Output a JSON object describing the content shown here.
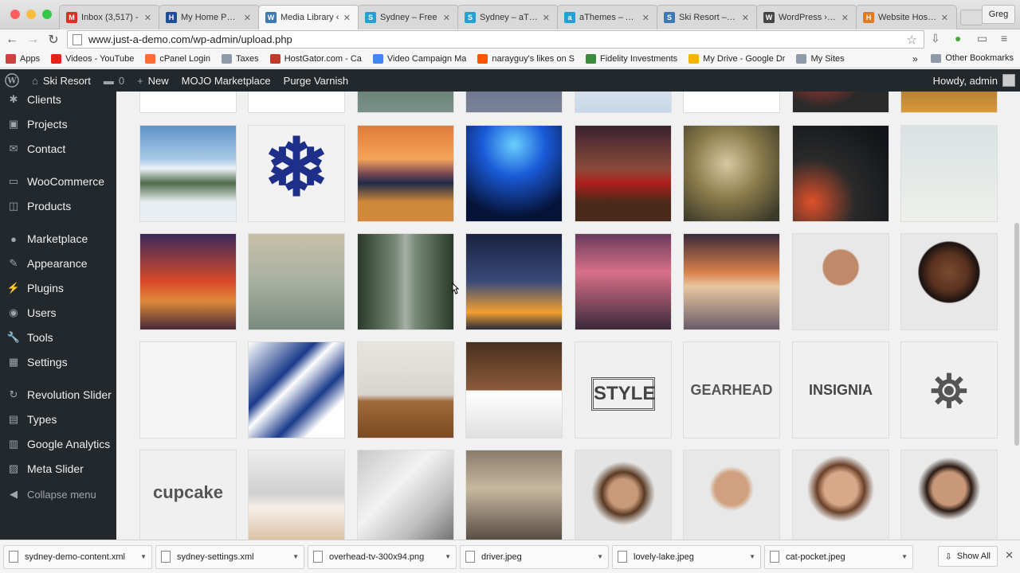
{
  "browser": {
    "tabs": [
      {
        "title": "Inbox (3,517) -",
        "icon": "gmail-icon",
        "color": "#d93025",
        "glyph": "M",
        "active": false
      },
      {
        "title": "My Home Page",
        "icon": "hostgator-icon",
        "color": "#1f4e99",
        "glyph": "H",
        "active": false
      },
      {
        "title": "Media Library ‹",
        "icon": "wordpress-admin-icon",
        "color": "#3d7ab5",
        "glyph": "W",
        "active": true
      },
      {
        "title": "Sydney – Free",
        "icon": "athemes-icon",
        "color": "#1fa3d6",
        "glyph": "S",
        "active": false
      },
      {
        "title": "Sydney – aThem",
        "icon": "athemes-icon",
        "color": "#1fa3d6",
        "glyph": "S",
        "active": false
      },
      {
        "title": "aThemes – Awe",
        "icon": "athemes-icon",
        "color": "#1fa3d6",
        "glyph": "a",
        "active": false
      },
      {
        "title": "Ski Resort – Jus",
        "icon": "site-icon",
        "color": "#3d7ab5",
        "glyph": "S",
        "active": false
      },
      {
        "title": "WordPress › Sy",
        "icon": "wordpress-icon",
        "color": "#464646",
        "glyph": "W",
        "active": false
      },
      {
        "title": "Website Hosting",
        "icon": "hosting-icon",
        "color": "#e07b24",
        "glyph": "H",
        "active": false
      }
    ],
    "profile": "Greg",
    "url": "www.just-a-demo.com/wp-admin/upload.php",
    "bookmarks": [
      {
        "label": "Apps",
        "color": "#d04040"
      },
      {
        "label": "Videos - YouTube",
        "color": "#e62117"
      },
      {
        "label": "cPanel Login",
        "color": "#ff6c2c"
      },
      {
        "label": "Taxes",
        "color": "#8e9aa8"
      },
      {
        "label": "HostGator.com - Ca",
        "color": "#c0392b"
      },
      {
        "label": "Video Campaign Ma",
        "color": "#4285f4"
      },
      {
        "label": "narayguy's likes on S",
        "color": "#ff5500"
      },
      {
        "label": "Fidelity Investments",
        "color": "#3b8c3b"
      },
      {
        "label": "My Drive - Google Dr",
        "color": "#f4b400"
      },
      {
        "label": "My Sites",
        "color": "#8e9aa8"
      }
    ],
    "other_bookmarks": "Other Bookmarks"
  },
  "adminbar": {
    "site": "Ski Resort",
    "comments": "0",
    "new": "New",
    "mojo": "MOJO Marketplace",
    "purge": "Purge Varnish",
    "howdy": "Howdy, admin"
  },
  "sidebar": {
    "items": [
      {
        "label": "Clients",
        "icon": "clients-icon",
        "glyph": "✱"
      },
      {
        "label": "Projects",
        "icon": "projects-icon",
        "glyph": "▣"
      },
      {
        "label": "Contact",
        "icon": "contact-icon",
        "glyph": "✉"
      },
      {
        "label": "WooCommerce",
        "icon": "woocommerce-icon",
        "glyph": "▭"
      },
      {
        "label": "Products",
        "icon": "products-icon",
        "glyph": "◫"
      },
      {
        "label": "Marketplace",
        "icon": "marketplace-icon",
        "glyph": "●"
      },
      {
        "label": "Appearance",
        "icon": "appearance-icon",
        "glyph": "✎"
      },
      {
        "label": "Plugins",
        "icon": "plugins-icon",
        "glyph": "⚡"
      },
      {
        "label": "Users",
        "icon": "users-icon",
        "glyph": "◉"
      },
      {
        "label": "Tools",
        "icon": "tools-icon",
        "glyph": "🔧"
      },
      {
        "label": "Settings",
        "icon": "settings-icon",
        "glyph": "▦"
      },
      {
        "label": "Revolution Slider",
        "icon": "revolution-slider-icon",
        "glyph": "↻"
      },
      {
        "label": "Types",
        "icon": "types-icon",
        "glyph": "▤"
      },
      {
        "label": "Google Analytics",
        "icon": "analytics-icon",
        "glyph": "▥"
      },
      {
        "label": "Meta Slider",
        "icon": "meta-slider-icon",
        "glyph": "▨"
      }
    ],
    "collapse": "Collapse menu"
  },
  "media_grid": {
    "tiles": [
      {
        "name": "thumb-top-1",
        "bg": "#ffffff"
      },
      {
        "name": "thumb-top-2",
        "bg": "#ffffff"
      },
      {
        "name": "thumb-top-3",
        "bg": "linear-gradient(#3a5a48,#7a9088)"
      },
      {
        "name": "thumb-top-4",
        "bg": "linear-gradient(#4b5a78,#7b8298)"
      },
      {
        "name": "thumb-top-5",
        "bg": "linear-gradient(#ffffff,#c8d8e8)"
      },
      {
        "name": "thumb-top-6",
        "bg": "#ffffff"
      },
      {
        "name": "thumb-top-7",
        "bg": "radial-gradient(circle at 30% 40%,#c0382e 20%,#2a2a2a 60%)"
      },
      {
        "name": "thumb-top-8",
        "bg": "linear-gradient(#3a2a10,#d89a3a)"
      },
      {
        "name": "thumb-snowy-mountains",
        "bg": "linear-gradient(#5d93c8 0%,#a9c9e6 35%,#eef2f5 45%,#4e6a4a 60%,#e9eef3 80%)"
      },
      {
        "name": "thumb-snowflake",
        "bg": "#f2f2f2",
        "label": "❄",
        "labelColor": "#1e2f8a",
        "labelSize": "100px",
        "labelTop": "-6px"
      },
      {
        "name": "thumb-sunset-lake",
        "bg": "linear-gradient(#e07a3a 0%,#f3a45a 35%,#7a4a52 50%,#1e2a4a 60%,#d0883a 80%)"
      },
      {
        "name": "thumb-concert",
        "bg": "radial-gradient(circle at 50% 20%,#6ad0ff 0%,#1a5ad8 35%,#061338 80%)"
      },
      {
        "name": "thumb-red-car",
        "bg": "linear-gradient(#3a2230 0%,#8a4a3a 45%,#b01e1e 60%,#4a2a1a 80%)"
      },
      {
        "name": "thumb-woman-field",
        "bg": "radial-gradient(circle at 45% 40%,#d8c8a0 0%,#8a7a4a 45%,#3a3a2a 90%)"
      },
      {
        "name": "thumb-bicycle-night",
        "bg": "radial-gradient(circle at 20% 80%,#e0502a 0%,#2a2a2a 40%,#101418 90%)"
      },
      {
        "name": "thumb-sky-plane",
        "bg": "linear-gradient(#d9e2e4,#eef0ea)"
      },
      {
        "name": "thumb-liberty-lightning",
        "bg": "linear-gradient(#3a2a5a 0%,#d84a2a 50%,#e08a3a 70%,#4a2a3a 100%)"
      },
      {
        "name": "thumb-daisy-lake",
        "bg": "linear-gradient(#c8c0a8 0%,#a8b0a0 50%,#7a8a80 100%)"
      },
      {
        "name": "thumb-forest-road",
        "bg": "linear-gradient(90deg,#2a3a2a 0%,#7a8a7a 40%,#a8b0a8 50%,#7a8a7a 60%,#2a3a2a 100%)"
      },
      {
        "name": "thumb-airplane",
        "bg": "linear-gradient(#1a2240 0%,#3a4a7a 50%,#f0a030 82%,#2a2a3a 100%)"
      },
      {
        "name": "thumb-flying-robot",
        "bg": "linear-gradient(#6a3a5a 0%,#d8708a 40%,#3a2a3a 100%)"
      },
      {
        "name": "thumb-girl-dock",
        "bg": "linear-gradient(#3a2a3a 0%,#d8804a 40%,#e8c8a0 55%,#6a5a6a 100%)"
      },
      {
        "name": "thumb-man-portrait",
        "bg": "radial-gradient(circle at 50% 35%,#c08a6a 0%,#c08a6a 22%,#e8e8e8 24%,#e8e8e8 100%)"
      },
      {
        "name": "thumb-woman-portrait",
        "bg": "radial-gradient(circle at 50% 40%,#7a4a30 0%,#5a3220 25%,#1a1210 40%,#e8e8e8 42%)"
      },
      {
        "name": "thumb-businessman",
        "bg": "#f5f5f5"
      },
      {
        "name": "thumb-iphones",
        "bg": "linear-gradient(135deg,#ffffff 0%,#1a3a8a 35%,#ffffff 45%,#1a3a8a 65%,#ffffff 80%)"
      },
      {
        "name": "thumb-desk-glasses",
        "bg": "linear-gradient(#e8e4de 0%,#d8d4ce 55%,#a06a3a 62%,#7a4a22 100%)"
      },
      {
        "name": "thumb-ipad-keyboard",
        "bg": "linear-gradient(#4a3020 0%,#8a5a3a 50%,#ffffff 51%,#e0e0e0 100%)"
      },
      {
        "name": "thumb-style-logo",
        "bg": "#f0f0f0",
        "label": "STYLE",
        "labelColor": "#444",
        "labelSize": "24px",
        "labelTop": "44px",
        "border": true
      },
      {
        "name": "thumb-gearhead-logo",
        "bg": "#f0f0f0",
        "label": "GEARHEAD",
        "labelColor": "#555",
        "labelSize": "18px",
        "labelTop": "50px"
      },
      {
        "name": "thumb-insignia-logo",
        "bg": "#f0f0f0",
        "label": "INSIGNIA",
        "labelColor": "#444",
        "labelSize": "18px",
        "labelTop": "50px"
      },
      {
        "name": "thumb-lighthouse-logo",
        "bg": "#f0f0f0",
        "label": "⛯",
        "labelColor": "#555",
        "labelSize": "58px",
        "labelTop": "28px"
      },
      {
        "name": "thumb-cupcake-logo",
        "bg": "#f0f0f0",
        "label": "cupcake",
        "labelColor": "#555",
        "labelSize": "22px",
        "labelTop": "40px"
      },
      {
        "name": "thumb-imac-iphone",
        "bg": "linear-gradient(#eeeeee 0%,#cfcfcf 45%,#f5f0e8 60%,#d8b89a 100%)"
      },
      {
        "name": "thumb-puzzle",
        "bg": "linear-gradient(135deg,#c8c8c8 0%,#f2f2f2 40%,#bdbdbd 70%,#6a6a6a 100%)"
      },
      {
        "name": "thumb-city-street",
        "bg": "linear-gradient(#8a7a6a 0%,#c8b8a0 40%,#4a4038 100%)"
      },
      {
        "name": "thumb-woman-glasses",
        "bg": "radial-gradient(circle at 50% 45%,#c89a7a 0%,#c89a7a 20%,#5a3a22 30%,#e4e4e4 45%)"
      },
      {
        "name": "thumb-man-bowtie",
        "bg": "radial-gradient(circle at 50% 40%,#d0a080 0%,#d0a080 22%,#e8e8e8 30%)"
      },
      {
        "name": "thumb-smiling-woman",
        "bg": "radial-gradient(circle at 50% 40%,#d8a888 0%,#d8a888 22%,#6a4028 32%,#eaeaea 45%)"
      },
      {
        "name": "thumb-smiling-man",
        "bg": "radial-gradient(circle at 50% 40%,#c89878 0%,#c89878 22%,#2a1a12 30%,#eaeaea 42%)"
      }
    ]
  },
  "downloads": {
    "files": [
      "sydney-demo-content.xml",
      "sydney-settings.xml",
      "overhead-tv-300x94.png",
      "driver.jpeg",
      "lovely-lake.jpeg",
      "cat-pocket.jpeg"
    ],
    "show_all": "Show All"
  }
}
